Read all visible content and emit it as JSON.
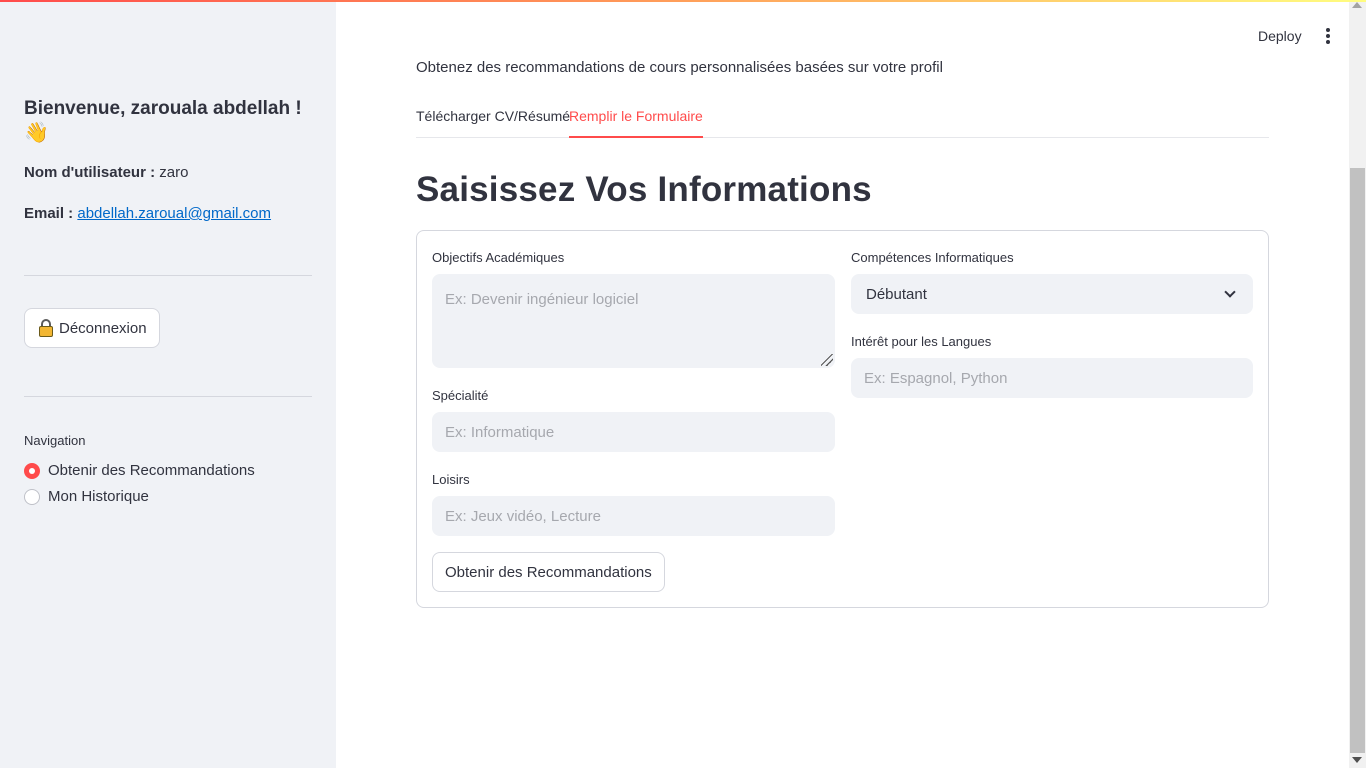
{
  "sidebar": {
    "welcome": "Bienvenue, zarouala abdellah !",
    "wave_emoji": "👋",
    "username_label": "Nom d'utilisateur :",
    "username_value": "zaro",
    "email_label": "Email :",
    "email_value": "abdellah.zaroual@gmail.com",
    "logout_label": "Déconnexion",
    "nav_title": "Navigation",
    "nav_options": [
      {
        "label": "Obtenir des Recommandations",
        "selected": true
      },
      {
        "label": "Mon Historique",
        "selected": false
      }
    ]
  },
  "header": {
    "deploy_label": "Deploy"
  },
  "main": {
    "subtitle": "Obtenez des recommandations de cours personnalisées basées sur votre profil",
    "tabs": [
      {
        "label": "Télécharger CV/Résumé",
        "active": false
      },
      {
        "label": "Remplir le Formulaire",
        "active": true
      }
    ],
    "title": "Saisissez Vos Informations",
    "form": {
      "academic_goals": {
        "label": "Objectifs Académiques",
        "placeholder": "Ex: Devenir ingénieur logiciel"
      },
      "specialty": {
        "label": "Spécialité",
        "placeholder": "Ex: Informatique"
      },
      "hobbies": {
        "label": "Loisirs",
        "placeholder": "Ex: Jeux vidéo, Lecture"
      },
      "computer_skills": {
        "label": "Compétences Informatiques",
        "value": "Débutant"
      },
      "languages": {
        "label": "Intérêt pour les Langues",
        "placeholder": "Ex: Espagnol, Python"
      },
      "submit_label": "Obtenir des Recommandations"
    }
  },
  "colors": {
    "accent": "#ff4b4b",
    "link": "#0068c9",
    "sidebar_bg": "#f0f2f6",
    "text": "#31333f"
  },
  "icons": [
    "wave-emoji-icon",
    "lock-icon",
    "kebab-menu-icon",
    "chevron-down-icon",
    "resize-handle-icon"
  ]
}
